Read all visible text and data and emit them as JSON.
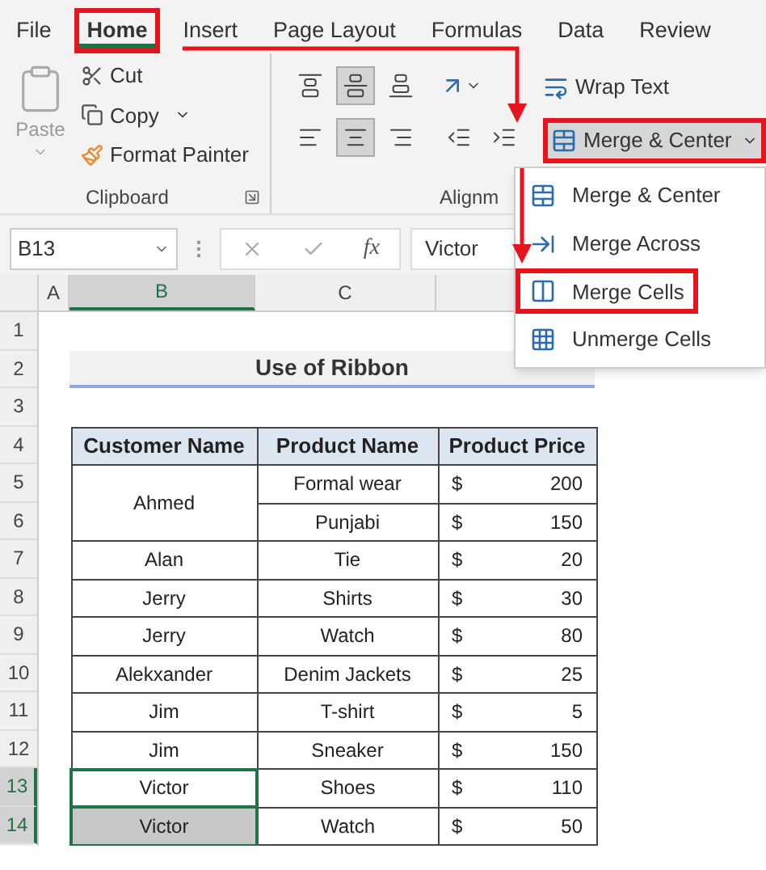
{
  "tabs": [
    {
      "label": "File",
      "selected": false,
      "highlighted": false
    },
    {
      "label": "Home",
      "selected": true,
      "highlighted": true
    },
    {
      "label": "Insert",
      "selected": false,
      "highlighted": false
    },
    {
      "label": "Page Layout",
      "selected": false,
      "highlighted": false
    },
    {
      "label": "Formulas",
      "selected": false,
      "highlighted": false
    },
    {
      "label": "Data",
      "selected": false,
      "highlighted": false
    },
    {
      "label": "Review",
      "selected": false,
      "highlighted": false
    }
  ],
  "clipboard": {
    "paste": "Paste",
    "cut": "Cut",
    "copy": "Copy",
    "format_painter": "Format Painter",
    "label": "Clipboard"
  },
  "alignment": {
    "label": "Alignm",
    "wrap_text": "Wrap Text",
    "merge_center": {
      "label": "Merge & Center",
      "highlighted": true
    }
  },
  "merge_menu": [
    {
      "label": "Merge & Center",
      "kind": "center",
      "highlighted": false
    },
    {
      "label": "Merge Across",
      "kind": "across",
      "highlighted": false
    },
    {
      "label": "Merge Cells",
      "kind": "cells",
      "highlighted": true
    },
    {
      "label": "Unmerge Cells",
      "kind": "unmerge",
      "highlighted": false
    }
  ],
  "formula_bar": {
    "name_box": "B13",
    "function_label": "fx",
    "value": "Victor"
  },
  "columns": [
    {
      "label": "A",
      "selected": false
    },
    {
      "label": "B",
      "selected": true
    },
    {
      "label": "C",
      "selected": false
    }
  ],
  "row_numbers": [
    {
      "label": "1",
      "selected": false
    },
    {
      "label": "2",
      "selected": false
    },
    {
      "label": "3",
      "selected": false
    },
    {
      "label": "4",
      "selected": false
    },
    {
      "label": "5",
      "selected": false
    },
    {
      "label": "6",
      "selected": false
    },
    {
      "label": "7",
      "selected": false
    },
    {
      "label": "8",
      "selected": false
    },
    {
      "label": "9",
      "selected": false
    },
    {
      "label": "10",
      "selected": false
    },
    {
      "label": "11",
      "selected": false
    },
    {
      "label": "12",
      "selected": false
    },
    {
      "label": "13",
      "selected": true
    },
    {
      "label": "14",
      "selected": true
    }
  ],
  "title": "Use of Ribbon",
  "table": {
    "columns": [
      "Customer Name",
      "Product Name",
      "Product Price"
    ],
    "groups": [
      {
        "customer": "Ahmed",
        "selected": false,
        "active": false,
        "items": [
          {
            "product": "Formal wear",
            "currency": "$",
            "price": "200"
          },
          {
            "product": "Punjabi",
            "currency": "$",
            "price": "150"
          }
        ]
      },
      {
        "customer": "Alan",
        "selected": false,
        "active": false,
        "items": [
          {
            "product": "Tie",
            "currency": "$",
            "price": "20"
          }
        ]
      },
      {
        "customer": "Jerry",
        "selected": false,
        "active": false,
        "items": [
          {
            "product": "Shirts",
            "currency": "$",
            "price": "30"
          }
        ]
      },
      {
        "customer": "Jerry",
        "selected": false,
        "active": false,
        "items": [
          {
            "product": "Watch",
            "currency": "$",
            "price": "80"
          }
        ]
      },
      {
        "customer": "Alekxander",
        "selected": false,
        "active": false,
        "items": [
          {
            "product": "Denim Jackets",
            "currency": "$",
            "price": "25"
          }
        ]
      },
      {
        "customer": "Jim",
        "selected": false,
        "active": false,
        "items": [
          {
            "product": "T-shirt",
            "currency": "$",
            "price": "5"
          }
        ]
      },
      {
        "customer": "Jim",
        "selected": false,
        "active": false,
        "items": [
          {
            "product": "Sneaker",
            "currency": "$",
            "price": "150"
          }
        ]
      },
      {
        "customer": "Victor",
        "selected": true,
        "active": true,
        "items": [
          {
            "product": "Shoes",
            "currency": "$",
            "price": "110"
          }
        ]
      },
      {
        "customer": "Victor",
        "selected": true,
        "active": false,
        "items": [
          {
            "product": "Watch",
            "currency": "$",
            "price": "50"
          }
        ]
      }
    ]
  }
}
